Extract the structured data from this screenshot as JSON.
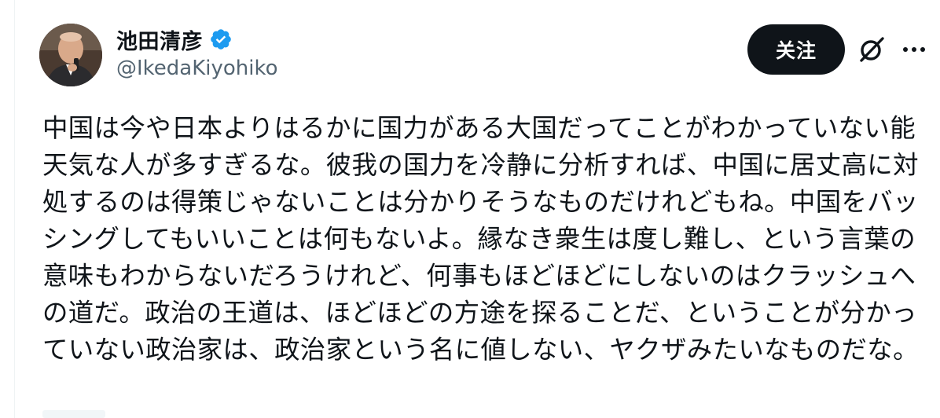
{
  "author": {
    "display_name": "池田清彦",
    "handle": "@IkedaKiyohiko",
    "verified": true
  },
  "actions": {
    "follow_label": "关注",
    "grok_icon": "grok-icon",
    "more_icon": "more-options-icon"
  },
  "tweet": {
    "text": "中国は今や日本よりはるかに国力がある大国だってことがわかっていない能天気な人が多すぎるな。彼我の国力を冷静に分析すれば、中国に居丈高に対処するのは得策じゃないことは分かりそうなものだけれどもね。中国をバッシングしてもいいことは何もないよ。縁なき衆生は度し難し、という言葉の意味もわからないだろうけれど、何事もほどほどにしないのはクラッシュへの道だ。政治の王道は、ほどほどの方途を探ることだ、ということが分かっていない政治家は、政治家という名に値しない、ヤクザみたいなものだな。"
  },
  "colors": {
    "verified_blue": "#1d9bf0",
    "secondary_text": "#536471",
    "button_bg": "#0f1419"
  }
}
